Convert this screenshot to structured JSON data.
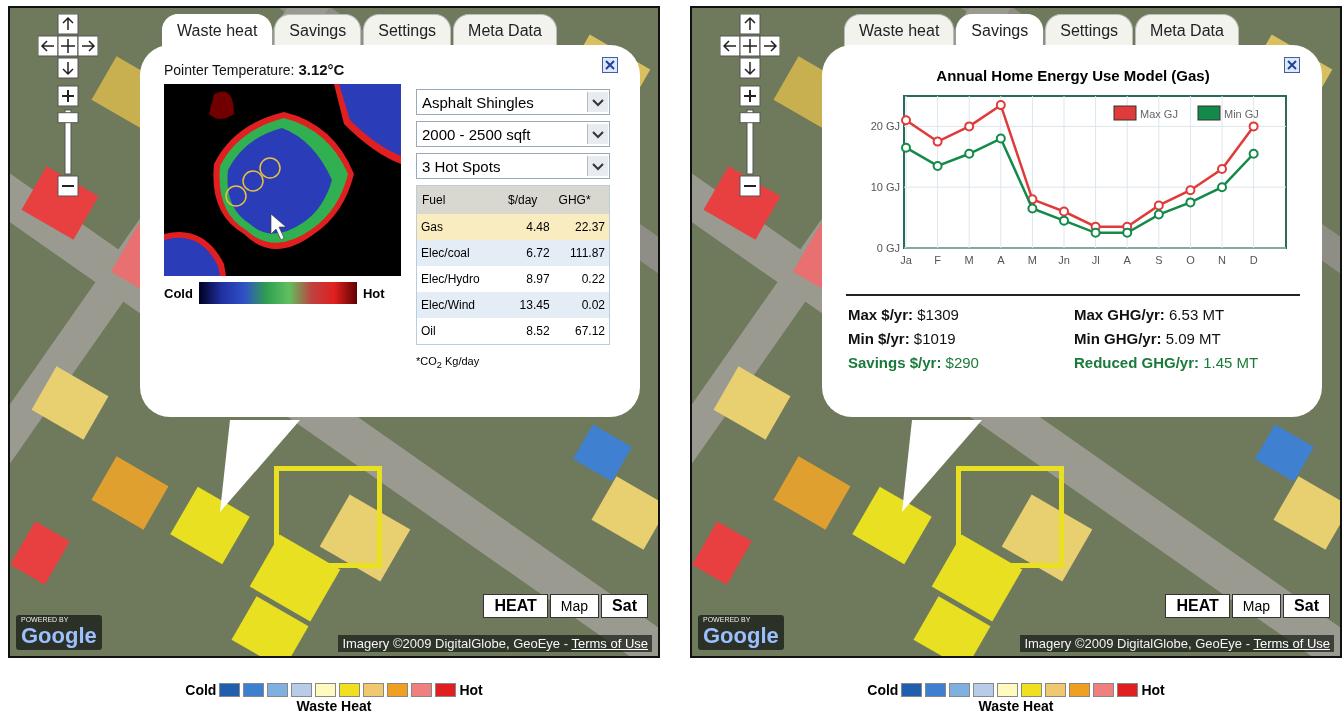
{
  "panels": [
    {
      "tabs": [
        {
          "label": "Waste heat",
          "selected": true
        },
        {
          "label": "Savings",
          "selected": false
        },
        {
          "label": "Settings",
          "selected": false
        },
        {
          "label": "Meta Data",
          "selected": false
        }
      ],
      "popup": {
        "kind": "heat_detail",
        "pointer_label": "Pointer Temperature: ",
        "pointer_value": "3.12°C",
        "scale_low": "Cold",
        "scale_high": "Hot",
        "dropdowns": [
          {
            "value": "Asphalt Shingles"
          },
          {
            "value": "2000 - 2500 sqft"
          },
          {
            "value": "3 Hot Spots"
          }
        ],
        "table": {
          "columns": [
            "Fuel",
            "$/day",
            "GHG*"
          ],
          "rows": [
            {
              "cells": [
                "Gas",
                "4.48",
                "22.37"
              ],
              "selected": true
            },
            {
              "cells": [
                "Elec/coal",
                "6.72",
                "111.87"
              ],
              "selected": false
            },
            {
              "cells": [
                "Elec/Hydro",
                "8.97",
                "0.22"
              ],
              "selected": false
            },
            {
              "cells": [
                "Elec/Wind",
                "13.45",
                "0.02"
              ],
              "selected": false
            },
            {
              "cells": [
                "Oil",
                "8.52",
                "67.12"
              ],
              "selected": false
            }
          ]
        },
        "footnote": "*CO$_{2}$ Kg/day"
      },
      "map_types": [
        {
          "label": "HEAT",
          "selected": true
        },
        {
          "label": "Map",
          "selected": false
        },
        {
          "label": "Sat",
          "selected": true
        }
      ],
      "zoom": {
        "level": 0.95
      },
      "logo_caption": "POWERED BY",
      "logo": "Google",
      "attribution": "Imagery ©2009 DigitalGlobe, GeoEye - ",
      "terms_link": "Terms of Use",
      "legend": {
        "low": "Cold",
        "high": "Hot",
        "title": "Waste Heat",
        "swatches": [
          {
            "color": "#1f5fae"
          },
          {
            "color": "#3f7fd0"
          },
          {
            "color": "#7fb0e0"
          },
          {
            "color": "#b8cce8"
          },
          {
            "color": "#fffbc0"
          },
          {
            "color": "#f0e020"
          },
          {
            "color": "#f0c870"
          },
          {
            "color": "#f0a020"
          },
          {
            "color": "#f08080"
          },
          {
            "color": "#e02020"
          }
        ]
      }
    },
    {
      "tabs": [
        {
          "label": "Waste heat",
          "selected": false
        },
        {
          "label": "Savings",
          "selected": true
        },
        {
          "label": "Settings",
          "selected": false
        },
        {
          "label": "Meta Data",
          "selected": false
        }
      ],
      "popup": {
        "kind": "savings_chart",
        "chart_data": {
          "type": "line",
          "title": "Annual Home Energy Use Model (Gas)",
          "categories": [
            "Ja",
            "F",
            "M",
            "A",
            "M",
            "Jn",
            "Jl",
            "A",
            "S",
            "O",
            "N",
            "D"
          ],
          "series": [
            {
              "name": "Max GJ",
              "color": "#e03a3a",
              "marker": "o",
              "values": [
                21,
                17.5,
                20,
                23.5,
                8,
                6,
                3.5,
                3.5,
                7,
                9.5,
                13,
                20
              ]
            },
            {
              "name": "Min GJ",
              "color": "#138a4a",
              "marker": "o",
              "values": [
                16.5,
                13.5,
                15.5,
                18,
                6.5,
                4.5,
                2.5,
                2.5,
                5.5,
                7.5,
                10,
                15.5
              ]
            }
          ],
          "grid": true,
          "legend": true,
          "ylim": [
            0,
            25
          ],
          "yticks": [
            {
              "value": 0,
              "label": "0 GJ"
            },
            {
              "value": 10,
              "label": "10 GJ"
            },
            {
              "value": 20,
              "label": "20 GJ"
            }
          ]
        },
        "stats": [
          {
            "text": "**Max $/yr:** $1309",
            "highlight": false
          },
          {
            "text": "**Max GHG/yr:** 6.53 MT",
            "highlight": false
          },
          {
            "text": "**Min $/yr:** $1019",
            "highlight": false
          },
          {
            "text": "**Min GHG/yr:** 5.09 MT",
            "highlight": false
          },
          {
            "text": "**Savings $/yr:** $290",
            "highlight": true
          },
          {
            "text": "**Reduced GHG/yr:** 1.45 MT",
            "highlight": true
          }
        ]
      },
      "map_types": [
        {
          "label": "HEAT",
          "selected": true
        },
        {
          "label": "Map",
          "selected": false
        },
        {
          "label": "Sat",
          "selected": true
        }
      ],
      "zoom": {
        "level": 0.95
      },
      "logo_caption": "POWERED BY",
      "logo": "Google",
      "attribution": "Imagery ©2009 DigitalGlobe, GeoEye - ",
      "terms_link": "Terms of Use",
      "legend": {
        "low": "Cold",
        "high": "Hot",
        "title": "Waste Heat",
        "swatches": [
          {
            "color": "#1f5fae"
          },
          {
            "color": "#3f7fd0"
          },
          {
            "color": "#7fb0e0"
          },
          {
            "color": "#b8cce8"
          },
          {
            "color": "#fffbc0"
          },
          {
            "color": "#f0e020"
          },
          {
            "color": "#f0c870"
          },
          {
            "color": "#f0a020"
          },
          {
            "color": "#f08080"
          },
          {
            "color": "#e02020"
          }
        ]
      }
    }
  ]
}
